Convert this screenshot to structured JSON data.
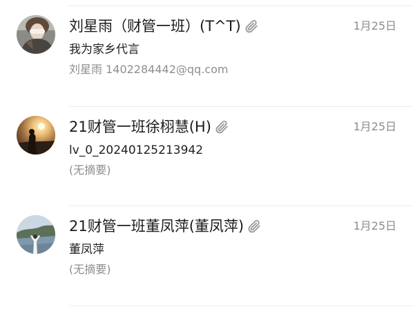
{
  "mails": [
    {
      "sender": "刘星雨（财管一班）(T^T)",
      "date": "1月25日",
      "subject": "我为家乡代言",
      "preview": "刘星雨  1402284442@qq.com",
      "has_attachment": true,
      "avatar": "person-photo-avatar",
      "attachment_icon": "paperclip-icon"
    },
    {
      "sender": "21财管一班徐栩慧(H)",
      "date": "1月25日",
      "subject": "lv_0_20240125213942",
      "preview": "(无摘要)",
      "has_attachment": true,
      "avatar": "sunset-photo-avatar",
      "attachment_icon": "paperclip-icon"
    },
    {
      "sender": "21财管一班董凤萍(董凤萍)",
      "date": "1月25日",
      "subject": "董凤萍",
      "preview": "(无摘要)",
      "has_attachment": true,
      "avatar": "landscape-photo-avatar",
      "attachment_icon": "paperclip-icon"
    }
  ],
  "colors": {
    "sender": "#1a1a1a",
    "subject": "#1f1f1f",
    "secondary": "#8e8e8e",
    "divider": "#ececec",
    "attachment_icon": "#9a9a9a"
  }
}
